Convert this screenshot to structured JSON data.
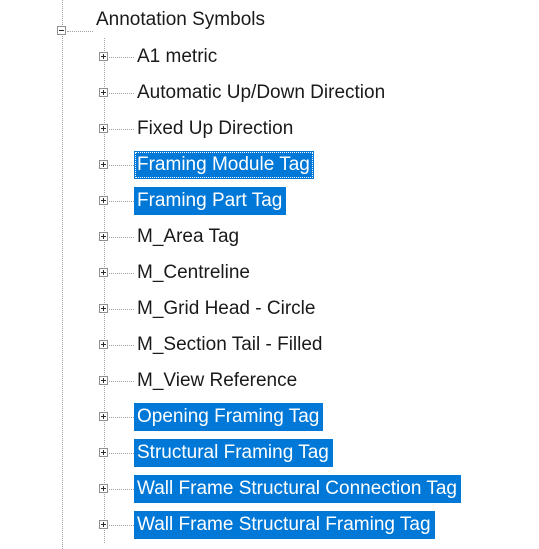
{
  "tree": {
    "root": {
      "label": "Annotation Symbols",
      "expanded": true
    },
    "children": [
      {
        "label": "A1 metric",
        "selected": false,
        "expanded": false
      },
      {
        "label": "Automatic Up/Down Direction",
        "selected": false,
        "expanded": false
      },
      {
        "label": "Fixed Up Direction",
        "selected": false,
        "expanded": false
      },
      {
        "label": "Framing Module Tag",
        "selected": true,
        "focused": true,
        "expanded": false
      },
      {
        "label": "Framing Part Tag",
        "selected": true,
        "expanded": false
      },
      {
        "label": "M_Area Tag",
        "selected": false,
        "expanded": false
      },
      {
        "label": "M_Centreline",
        "selected": false,
        "expanded": false
      },
      {
        "label": "M_Grid Head - Circle",
        "selected": false,
        "expanded": false
      },
      {
        "label": "M_Section Tail - Filled",
        "selected": false,
        "expanded": false
      },
      {
        "label": "M_View Reference",
        "selected": false,
        "expanded": false
      },
      {
        "label": "Opening Framing Tag",
        "selected": true,
        "expanded": false
      },
      {
        "label": "Structural Framing Tag",
        "selected": true,
        "expanded": false
      },
      {
        "label": "Wall Frame Structural Connection Tag",
        "selected": true,
        "expanded": false
      },
      {
        "label": "Wall Frame Structural Framing Tag",
        "selected": true,
        "expanded": false
      }
    ],
    "colors": {
      "selection": "#0078d7",
      "selected_text": "#ffffff",
      "text": "#1a1a1a",
      "connector": "#a0a0a0"
    }
  }
}
